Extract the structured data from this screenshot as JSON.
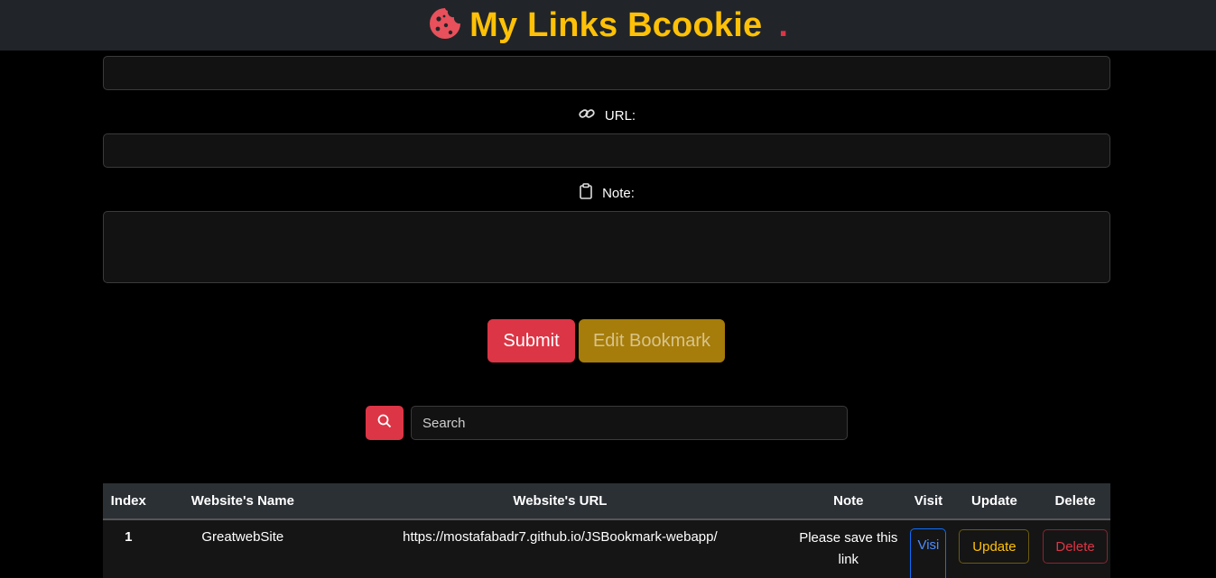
{
  "header": {
    "title": "My Links Bcookie",
    "dot": ".",
    "logo_icon": "cookie-icon",
    "colors": {
      "title": "#ffc107",
      "logo": "#dc3545"
    }
  },
  "form": {
    "name_value": "",
    "url_label": "URL:",
    "url_icon": "link-icon",
    "url_value": "",
    "note_label": "Note:",
    "note_icon": "clipboard-icon",
    "note_value": ""
  },
  "buttons": {
    "submit_label": "Submit",
    "edit_label": "Edit Bookmark"
  },
  "search": {
    "icon": "search-icon",
    "placeholder": "Search"
  },
  "table": {
    "headers": {
      "index": "Index",
      "name": "Website's Name",
      "url": "Website's URL",
      "note": "Note",
      "visit": "Visit",
      "update": "Update",
      "delete": "Delete"
    },
    "rows": [
      {
        "index": "1",
        "name": "GreatwebSite",
        "url": "https://mostafabadr7.github.io/JSBookmark-webapp/",
        "note": "Please save this link",
        "visit_label": "Visi",
        "update_label": "Update",
        "delete_label": "Delete"
      }
    ]
  }
}
